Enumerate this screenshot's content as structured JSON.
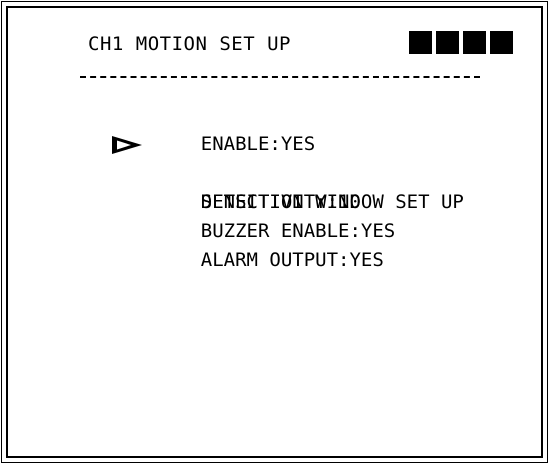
{
  "screen": {
    "title": "CH1 MOTION SET UP",
    "status_blocks": 4
  },
  "menu": {
    "selected_index": 1,
    "items": [
      {
        "label": "ENABLE:YES",
        "name": "menu-item-enable"
      },
      {
        "label": "DETECTION WINDOW SET UP",
        "name": "menu-item-detection-window"
      },
      {
        "label": "SENSITIVITY:10",
        "name": "menu-item-sensitivity"
      },
      {
        "label": "BUZZER ENABLE:YES",
        "name": "menu-item-buzzer-enable"
      },
      {
        "label": "ALARM OUTPUT:YES",
        "name": "menu-item-alarm-output"
      }
    ]
  },
  "icons": {
    "cursor": "triangle-right-icon"
  },
  "colors": {
    "background": "#ffffff",
    "foreground": "#000000"
  }
}
